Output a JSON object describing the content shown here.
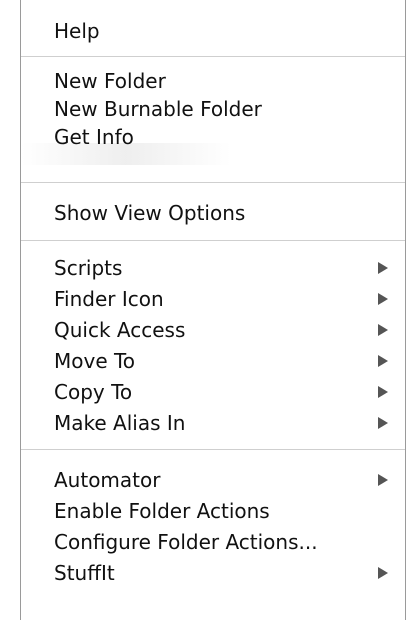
{
  "menu": {
    "groups": [
      {
        "items": [
          {
            "label": "Help",
            "submenu": false
          }
        ]
      },
      {
        "items": [
          {
            "label": "New Folder",
            "submenu": false
          },
          {
            "label": "New Burnable Folder",
            "submenu": false
          },
          {
            "label": "Get Info",
            "submenu": false
          }
        ]
      },
      {
        "items": [
          {
            "label": "Show View Options",
            "submenu": false
          }
        ]
      },
      {
        "items": [
          {
            "label": "Scripts",
            "submenu": true
          },
          {
            "label": "Finder Icon",
            "submenu": true
          },
          {
            "label": "Quick Access",
            "submenu": true
          },
          {
            "label": "Move To",
            "submenu": true
          },
          {
            "label": "Copy To",
            "submenu": true
          },
          {
            "label": "Make Alias In",
            "submenu": true
          }
        ]
      },
      {
        "items": [
          {
            "label": "Automator",
            "submenu": true
          },
          {
            "label": "Enable Folder Actions",
            "submenu": false
          },
          {
            "label": "Configure Folder Actions...",
            "submenu": false
          },
          {
            "label": "StuffIt",
            "submenu": true
          }
        ]
      }
    ]
  }
}
